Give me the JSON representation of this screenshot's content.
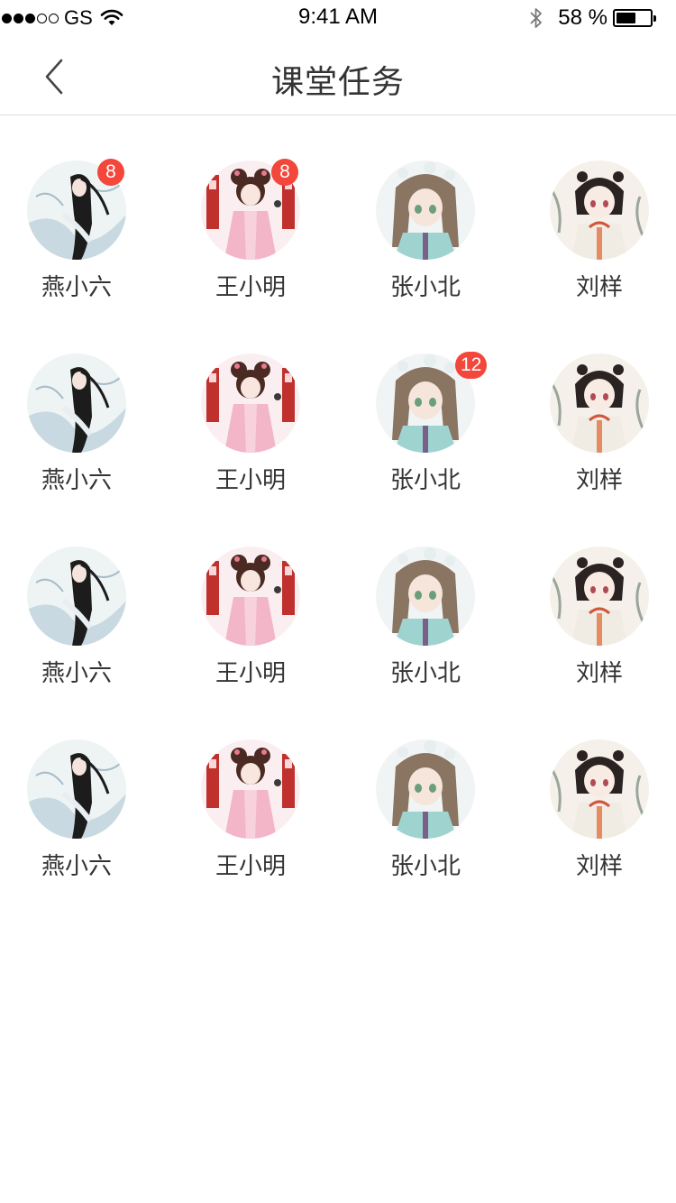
{
  "status_bar": {
    "carrier": "GS",
    "time": "9:41 AM",
    "battery_percent_label": "58 %",
    "battery_level": 0.58
  },
  "nav": {
    "title": "课堂任务",
    "back_icon": "chevron-left-icon"
  },
  "grid": {
    "columns": 4,
    "rows": [
      [
        {
          "name": "燕小六",
          "avatar": "avatar-1",
          "badge": "8"
        },
        {
          "name": "王小明",
          "avatar": "avatar-2",
          "badge": "8"
        },
        {
          "name": "张小北",
          "avatar": "avatar-3",
          "badge": ""
        },
        {
          "name": "刘样",
          "avatar": "avatar-4",
          "badge": ""
        }
      ],
      [
        {
          "name": "燕小六",
          "avatar": "avatar-1",
          "badge": ""
        },
        {
          "name": "王小明",
          "avatar": "avatar-2",
          "badge": ""
        },
        {
          "name": "张小北",
          "avatar": "avatar-3",
          "badge": "12"
        },
        {
          "name": "刘样",
          "avatar": "avatar-4",
          "badge": ""
        }
      ],
      [
        {
          "name": "燕小六",
          "avatar": "avatar-1",
          "badge": ""
        },
        {
          "name": "王小明",
          "avatar": "avatar-2",
          "badge": ""
        },
        {
          "name": "张小北",
          "avatar": "avatar-3",
          "badge": ""
        },
        {
          "name": "刘样",
          "avatar": "avatar-4",
          "badge": ""
        }
      ],
      [
        {
          "name": "燕小六",
          "avatar": "avatar-1",
          "badge": ""
        },
        {
          "name": "王小明",
          "avatar": "avatar-2",
          "badge": ""
        },
        {
          "name": "张小北",
          "avatar": "avatar-3",
          "badge": ""
        },
        {
          "name": "刘样",
          "avatar": "avatar-4",
          "badge": ""
        }
      ]
    ]
  },
  "colors": {
    "badge": "#f2473a",
    "divider": "#dcdcdc",
    "text": "#333333"
  }
}
